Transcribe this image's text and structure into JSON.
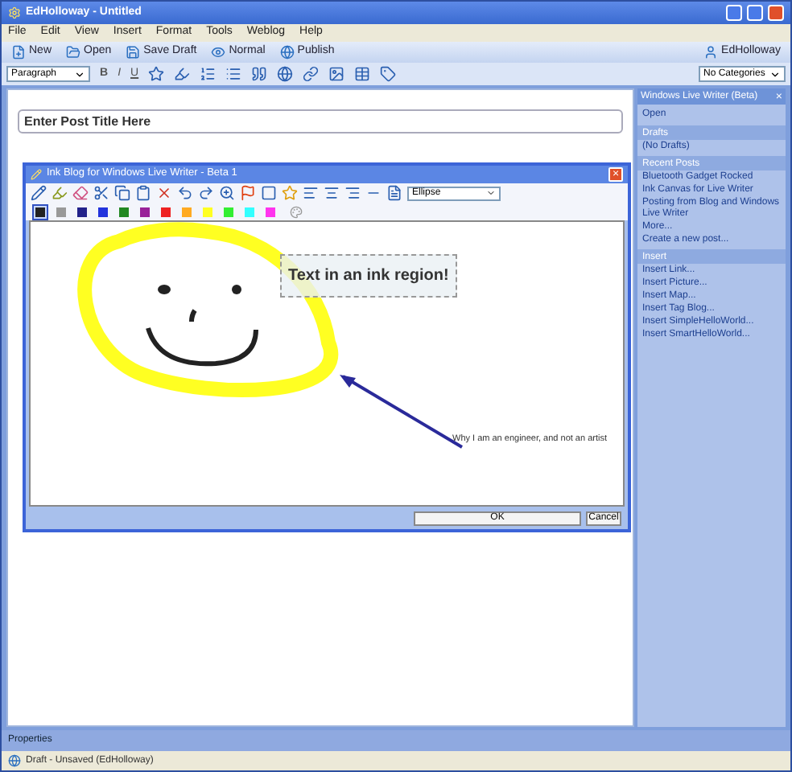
{
  "window": {
    "title": "EdHolloway - Untitled"
  },
  "menu": [
    "File",
    "Edit",
    "View",
    "Insert",
    "Format",
    "Tools",
    "Weblog",
    "Help"
  ],
  "toolbar": {
    "new": "New",
    "open": "Open",
    "save": "Save Draft",
    "view": "Normal",
    "publish": "Publish",
    "account": "EdHolloway"
  },
  "format_bar": {
    "style": "Paragraph",
    "bold": "B",
    "italic": "I",
    "underline": "U",
    "categories": "No Categories"
  },
  "post_title": {
    "value": "Enter Post Title Here"
  },
  "sidebar": {
    "title": "Windows Live Writer (Beta)",
    "close": "×",
    "open": "Open",
    "sections": [
      {
        "heading": "Drafts",
        "items": [
          "(No Drafts)"
        ]
      },
      {
        "heading": "Recent Posts",
        "items": [
          "Bluetooth Gadget Rocked",
          "Ink Canvas for Live Writer",
          "Posting from Blog and Windows Live Writer",
          "More...",
          "Create a new post..."
        ]
      },
      {
        "heading": "Insert",
        "items": [
          "Insert Link...",
          "Insert Picture...",
          "Insert Map...",
          "Insert Tag Blog...",
          "Insert SimpleHelloWorld...",
          "Insert SmartHelloWorld..."
        ]
      }
    ]
  },
  "dialog": {
    "title": "Ink Blog for Windows Live Writer - Beta 1",
    "close": "×",
    "shape_select": "Ellipse",
    "palette": [
      {
        "color": "#222222",
        "selected": true
      },
      {
        "color": "#999999",
        "selected": false
      },
      {
        "color": "#22228a",
        "selected": false
      },
      {
        "color": "#2233dd",
        "selected": false
      },
      {
        "color": "#228822",
        "selected": false
      },
      {
        "color": "#992299",
        "selected": false
      },
      {
        "color": "#ee2222",
        "selected": false
      },
      {
        "color": "#ffaa22",
        "selected": false
      },
      {
        "color": "#ffff22",
        "selected": false
      },
      {
        "color": "#33ee33",
        "selected": false
      },
      {
        "color": "#33ffff",
        "selected": false
      },
      {
        "color": "#ff33ee",
        "selected": false
      }
    ],
    "text_box": "Text in an ink region!",
    "note": "Why I am an engineer, and not an artist",
    "ok": "OK",
    "cancel": "Cancel"
  },
  "properties": "Properties",
  "status_bar": "Draft - Unsaved (EdHolloway)"
}
